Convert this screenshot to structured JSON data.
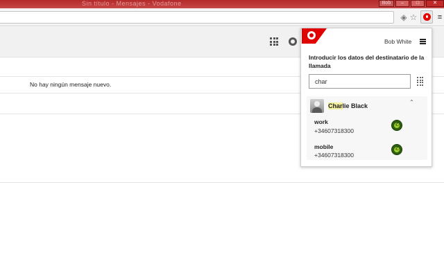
{
  "browser": {
    "title_faded": "Sin título - Mensajes - Vodafone",
    "window_controls": {
      "user": "Bob",
      "minimize": "–",
      "maximize": "□",
      "close": "✕"
    },
    "toolbar_icons": [
      "translate-icon",
      "star-icon",
      "extension-icon",
      "menu-icon"
    ]
  },
  "app": {
    "empty_message": "No hay ningún mensaje nuevo."
  },
  "popup": {
    "brand_color": "#e00000",
    "user_name": "Bob White",
    "prompt": "Introducir los datos del destinatario de la llamada",
    "search": {
      "value": "char",
      "placeholder": ""
    },
    "contact": {
      "name_highlight": "Char",
      "name_rest": "lie Black",
      "highlight_color": "#f2ef9e",
      "phones": [
        {
          "label": "work",
          "number": "+34607318300"
        },
        {
          "label": "mobile",
          "number": "+34607318300"
        }
      ]
    }
  }
}
